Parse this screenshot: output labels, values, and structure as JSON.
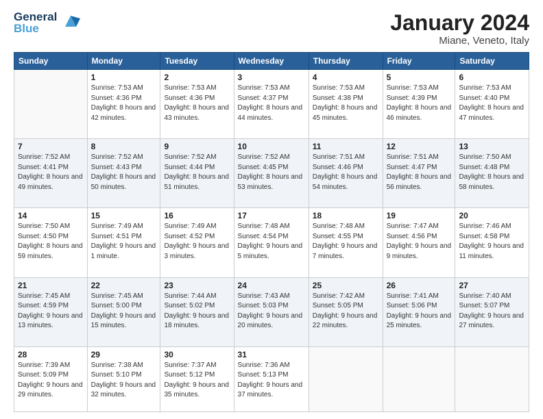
{
  "logo": {
    "line1": "General",
    "line2": "Blue"
  },
  "title": "January 2024",
  "subtitle": "Miane, Veneto, Italy",
  "weekdays": [
    "Sunday",
    "Monday",
    "Tuesday",
    "Wednesday",
    "Thursday",
    "Friday",
    "Saturday"
  ],
  "weeks": [
    [
      {
        "day": "",
        "sunrise": "",
        "sunset": "",
        "daylight": ""
      },
      {
        "day": "1",
        "sunrise": "Sunrise: 7:53 AM",
        "sunset": "Sunset: 4:36 PM",
        "daylight": "Daylight: 8 hours and 42 minutes."
      },
      {
        "day": "2",
        "sunrise": "Sunrise: 7:53 AM",
        "sunset": "Sunset: 4:36 PM",
        "daylight": "Daylight: 8 hours and 43 minutes."
      },
      {
        "day": "3",
        "sunrise": "Sunrise: 7:53 AM",
        "sunset": "Sunset: 4:37 PM",
        "daylight": "Daylight: 8 hours and 44 minutes."
      },
      {
        "day": "4",
        "sunrise": "Sunrise: 7:53 AM",
        "sunset": "Sunset: 4:38 PM",
        "daylight": "Daylight: 8 hours and 45 minutes."
      },
      {
        "day": "5",
        "sunrise": "Sunrise: 7:53 AM",
        "sunset": "Sunset: 4:39 PM",
        "daylight": "Daylight: 8 hours and 46 minutes."
      },
      {
        "day": "6",
        "sunrise": "Sunrise: 7:53 AM",
        "sunset": "Sunset: 4:40 PM",
        "daylight": "Daylight: 8 hours and 47 minutes."
      }
    ],
    [
      {
        "day": "7",
        "sunrise": "Sunrise: 7:52 AM",
        "sunset": "Sunset: 4:41 PM",
        "daylight": "Daylight: 8 hours and 49 minutes."
      },
      {
        "day": "8",
        "sunrise": "Sunrise: 7:52 AM",
        "sunset": "Sunset: 4:43 PM",
        "daylight": "Daylight: 8 hours and 50 minutes."
      },
      {
        "day": "9",
        "sunrise": "Sunrise: 7:52 AM",
        "sunset": "Sunset: 4:44 PM",
        "daylight": "Daylight: 8 hours and 51 minutes."
      },
      {
        "day": "10",
        "sunrise": "Sunrise: 7:52 AM",
        "sunset": "Sunset: 4:45 PM",
        "daylight": "Daylight: 8 hours and 53 minutes."
      },
      {
        "day": "11",
        "sunrise": "Sunrise: 7:51 AM",
        "sunset": "Sunset: 4:46 PM",
        "daylight": "Daylight: 8 hours and 54 minutes."
      },
      {
        "day": "12",
        "sunrise": "Sunrise: 7:51 AM",
        "sunset": "Sunset: 4:47 PM",
        "daylight": "Daylight: 8 hours and 56 minutes."
      },
      {
        "day": "13",
        "sunrise": "Sunrise: 7:50 AM",
        "sunset": "Sunset: 4:48 PM",
        "daylight": "Daylight: 8 hours and 58 minutes."
      }
    ],
    [
      {
        "day": "14",
        "sunrise": "Sunrise: 7:50 AM",
        "sunset": "Sunset: 4:50 PM",
        "daylight": "Daylight: 8 hours and 59 minutes."
      },
      {
        "day": "15",
        "sunrise": "Sunrise: 7:49 AM",
        "sunset": "Sunset: 4:51 PM",
        "daylight": "Daylight: 9 hours and 1 minute."
      },
      {
        "day": "16",
        "sunrise": "Sunrise: 7:49 AM",
        "sunset": "Sunset: 4:52 PM",
        "daylight": "Daylight: 9 hours and 3 minutes."
      },
      {
        "day": "17",
        "sunrise": "Sunrise: 7:48 AM",
        "sunset": "Sunset: 4:54 PM",
        "daylight": "Daylight: 9 hours and 5 minutes."
      },
      {
        "day": "18",
        "sunrise": "Sunrise: 7:48 AM",
        "sunset": "Sunset: 4:55 PM",
        "daylight": "Daylight: 9 hours and 7 minutes."
      },
      {
        "day": "19",
        "sunrise": "Sunrise: 7:47 AM",
        "sunset": "Sunset: 4:56 PM",
        "daylight": "Daylight: 9 hours and 9 minutes."
      },
      {
        "day": "20",
        "sunrise": "Sunrise: 7:46 AM",
        "sunset": "Sunset: 4:58 PM",
        "daylight": "Daylight: 9 hours and 11 minutes."
      }
    ],
    [
      {
        "day": "21",
        "sunrise": "Sunrise: 7:45 AM",
        "sunset": "Sunset: 4:59 PM",
        "daylight": "Daylight: 9 hours and 13 minutes."
      },
      {
        "day": "22",
        "sunrise": "Sunrise: 7:45 AM",
        "sunset": "Sunset: 5:00 PM",
        "daylight": "Daylight: 9 hours and 15 minutes."
      },
      {
        "day": "23",
        "sunrise": "Sunrise: 7:44 AM",
        "sunset": "Sunset: 5:02 PM",
        "daylight": "Daylight: 9 hours and 18 minutes."
      },
      {
        "day": "24",
        "sunrise": "Sunrise: 7:43 AM",
        "sunset": "Sunset: 5:03 PM",
        "daylight": "Daylight: 9 hours and 20 minutes."
      },
      {
        "day": "25",
        "sunrise": "Sunrise: 7:42 AM",
        "sunset": "Sunset: 5:05 PM",
        "daylight": "Daylight: 9 hours and 22 minutes."
      },
      {
        "day": "26",
        "sunrise": "Sunrise: 7:41 AM",
        "sunset": "Sunset: 5:06 PM",
        "daylight": "Daylight: 9 hours and 25 minutes."
      },
      {
        "day": "27",
        "sunrise": "Sunrise: 7:40 AM",
        "sunset": "Sunset: 5:07 PM",
        "daylight": "Daylight: 9 hours and 27 minutes."
      }
    ],
    [
      {
        "day": "28",
        "sunrise": "Sunrise: 7:39 AM",
        "sunset": "Sunset: 5:09 PM",
        "daylight": "Daylight: 9 hours and 29 minutes."
      },
      {
        "day": "29",
        "sunrise": "Sunrise: 7:38 AM",
        "sunset": "Sunset: 5:10 PM",
        "daylight": "Daylight: 9 hours and 32 minutes."
      },
      {
        "day": "30",
        "sunrise": "Sunrise: 7:37 AM",
        "sunset": "Sunset: 5:12 PM",
        "daylight": "Daylight: 9 hours and 35 minutes."
      },
      {
        "day": "31",
        "sunrise": "Sunrise: 7:36 AM",
        "sunset": "Sunset: 5:13 PM",
        "daylight": "Daylight: 9 hours and 37 minutes."
      },
      {
        "day": "",
        "sunrise": "",
        "sunset": "",
        "daylight": ""
      },
      {
        "day": "",
        "sunrise": "",
        "sunset": "",
        "daylight": ""
      },
      {
        "day": "",
        "sunrise": "",
        "sunset": "",
        "daylight": ""
      }
    ]
  ],
  "row_shades": [
    false,
    true,
    false,
    true,
    false
  ]
}
